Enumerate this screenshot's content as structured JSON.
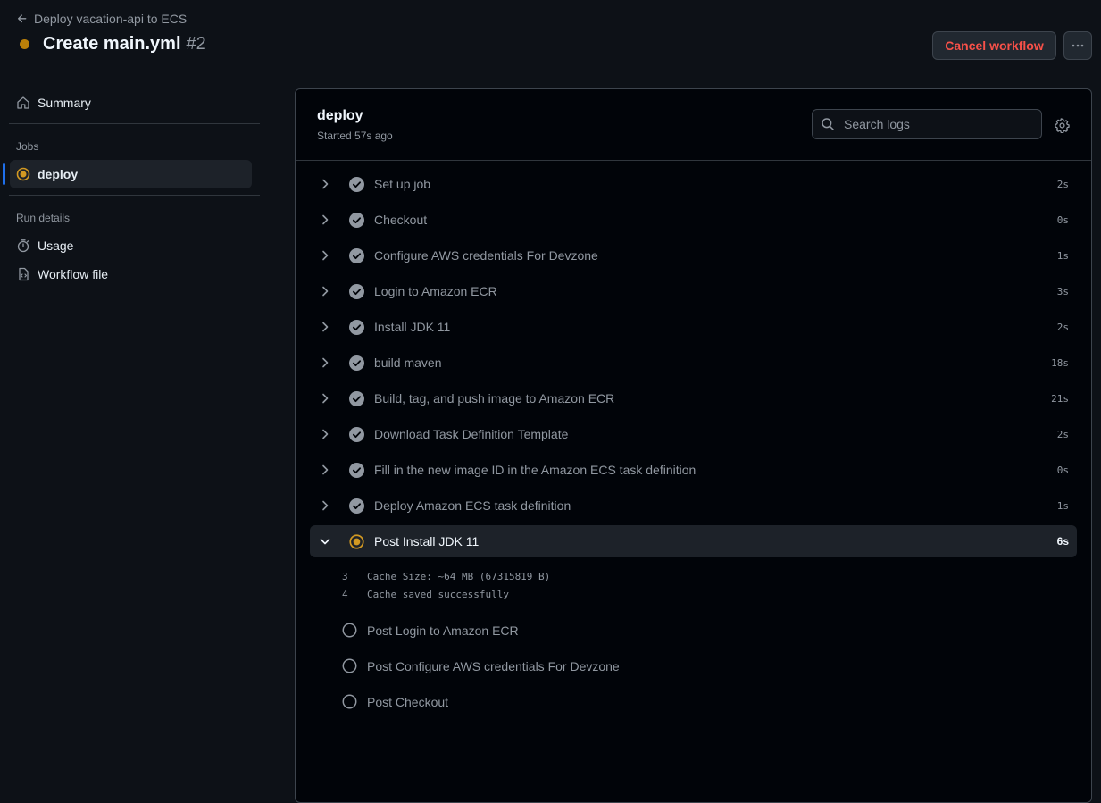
{
  "header": {
    "back_link": "Deploy vacation-api to ECS",
    "title": "Create main.yml",
    "run_number": "#2",
    "cancel_label": "Cancel workflow",
    "status_color": "#bb8009"
  },
  "sidebar": {
    "summary_label": "Summary",
    "jobs_heading": "Jobs",
    "active_job": "deploy",
    "run_details_heading": "Run details",
    "usage_label": "Usage",
    "workflow_file_label": "Workflow file"
  },
  "job": {
    "name": "deploy",
    "started": "Started 57s ago",
    "search_placeholder": "Search logs"
  },
  "steps": [
    {
      "name": "Set up job",
      "duration": "2s",
      "status": "success"
    },
    {
      "name": "Checkout",
      "duration": "0s",
      "status": "success"
    },
    {
      "name": "Configure AWS credentials For Devzone",
      "duration": "1s",
      "status": "success"
    },
    {
      "name": "Login to Amazon ECR",
      "duration": "3s",
      "status": "success"
    },
    {
      "name": "Install JDK 11",
      "duration": "2s",
      "status": "success"
    },
    {
      "name": "build maven",
      "duration": "18s",
      "status": "success"
    },
    {
      "name": "Build, tag, and push image to Amazon ECR",
      "duration": "21s",
      "status": "success"
    },
    {
      "name": "Download Task Definition Template",
      "duration": "2s",
      "status": "success"
    },
    {
      "name": "Fill in the new image ID in the Amazon ECS task definition",
      "duration": "0s",
      "status": "success"
    },
    {
      "name": "Deploy Amazon ECS task definition",
      "duration": "1s",
      "status": "success"
    },
    {
      "name": "Post Install JDK 11",
      "duration": "6s",
      "status": "in_progress",
      "expanded": true
    }
  ],
  "log_lines": [
    {
      "num": "3",
      "text": "Cache Size: ~64 MB (67315819 B)"
    },
    {
      "num": "4",
      "text": "Cache saved successfully"
    }
  ],
  "pending_steps": [
    {
      "name": "Post Login to Amazon ECR"
    },
    {
      "name": "Post Configure AWS credentials For Devzone"
    },
    {
      "name": "Post Checkout"
    }
  ],
  "colors": {
    "background": "#0d1117",
    "panel": "#010409",
    "success_icon": "#9198a1",
    "in_progress": "#d29922",
    "cancel": "#f85149",
    "accent": "#1f6feb"
  }
}
